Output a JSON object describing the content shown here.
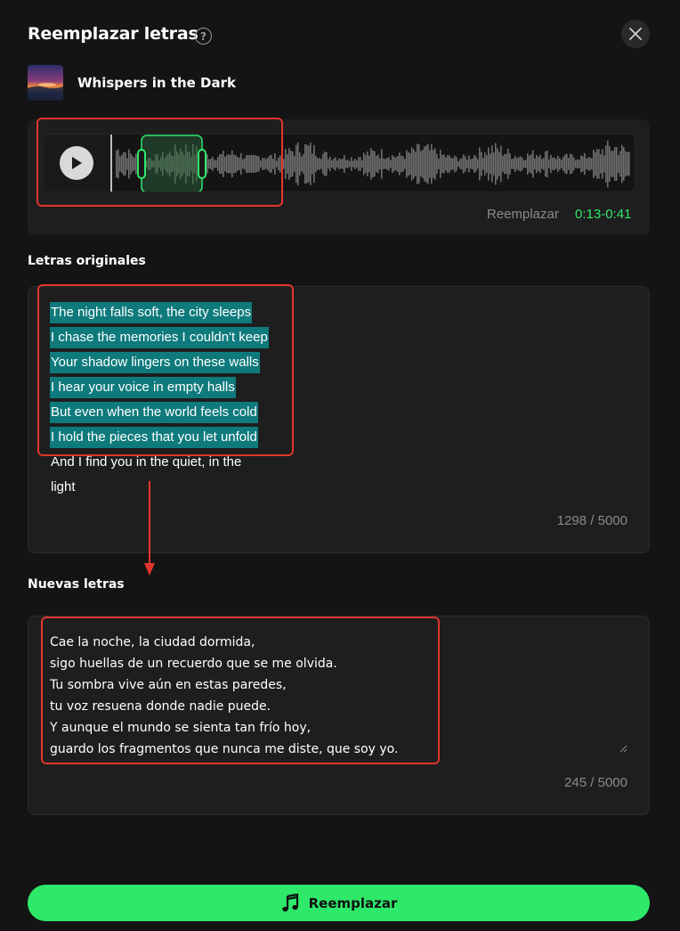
{
  "dialog": {
    "title": "Reemplazar letras",
    "help_icon": "?"
  },
  "song": {
    "title": "Whispers in the Dark"
  },
  "player": {
    "replace_label": "Reemplazar",
    "replace_range": "0:13-0:41",
    "accent_color": "#2ee86a"
  },
  "original": {
    "label": "Letras originales",
    "lines": [
      "The night falls soft, the city sleeps",
      "I chase the memories I couldn't keep",
      "Your shadow lingers on these walls",
      "I hear your voice in empty halls",
      "But even when the world feels cold",
      "I hold the pieces that you let unfold",
      "And I find you in the quiet, in the",
      "light"
    ],
    "selected_line_count": 6,
    "counter": "1298 / 5000",
    "selection_color": "#0f7a7c"
  },
  "new_lyrics": {
    "label": "Nuevas letras",
    "lines": [
      "Cae la noche, la ciudad dormida,",
      "sigo huellas de un recuerdo que se me olvida.",
      "Tu sombra vive aún en estas paredes,",
      "tu voz resuena donde nadie puede.",
      "Y aunque el mundo se sienta tan frío hoy,",
      "guardo los fragmentos que nunca me diste, que soy yo."
    ],
    "counter": "245 / 5000"
  },
  "submit": {
    "label": "Reemplazar",
    "icon": "music-notes-icon"
  },
  "annotation_color": "#e0362c"
}
